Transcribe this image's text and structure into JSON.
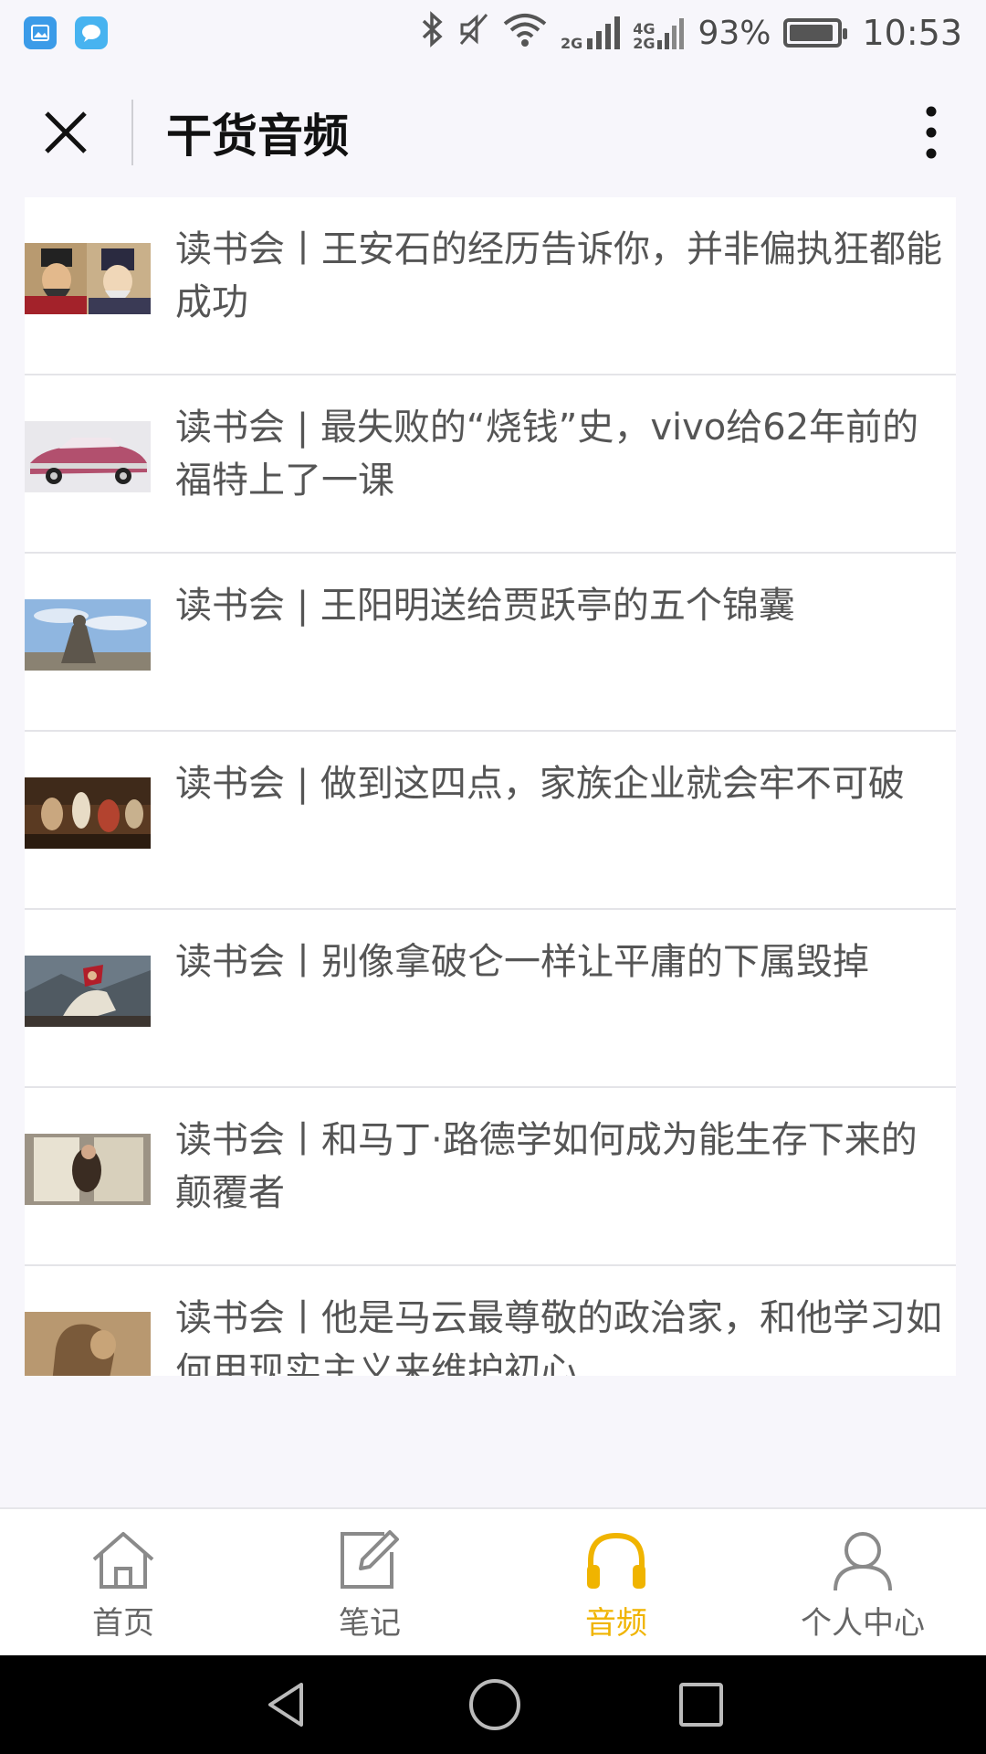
{
  "status_bar": {
    "net_2g": "2G",
    "net_4g": "4G",
    "net_2g_b": "2G",
    "battery_percent": "93%",
    "time": "10:53"
  },
  "header": {
    "title": "干货音频"
  },
  "items": [
    {
      "title": "读书会丨王安石的经历告诉你，并非偏执狂都能成功"
    },
    {
      "title": "读书会 | 最失败的“烧钱”史，vivo给62年前的福特上了一课"
    },
    {
      "title": "读书会 | 王阳明送给贾跃亭的五个锦囊"
    },
    {
      "title": "读书会 | 做到这四点，家族企业就会牢不可破"
    },
    {
      "title": "读书会丨别像拿破仑一样让平庸的下属毁掉"
    },
    {
      "title": "读书会丨和马丁·路德学如何成为能生存下来的颠覆者"
    },
    {
      "title": "读书会丨他是马云最尊敬的政治家，和他学习如何用现实主义来维护初心"
    }
  ],
  "tabs": [
    {
      "label": "首页",
      "icon": "home-icon",
      "active": false
    },
    {
      "label": "笔记",
      "icon": "edit-note-icon",
      "active": false
    },
    {
      "label": "音频",
      "icon": "headphones-icon",
      "active": true
    },
    {
      "label": "个人中心",
      "icon": "person-icon",
      "active": false
    }
  ],
  "colors": {
    "accent": "#f0b400",
    "background": "#f7f6fb"
  }
}
